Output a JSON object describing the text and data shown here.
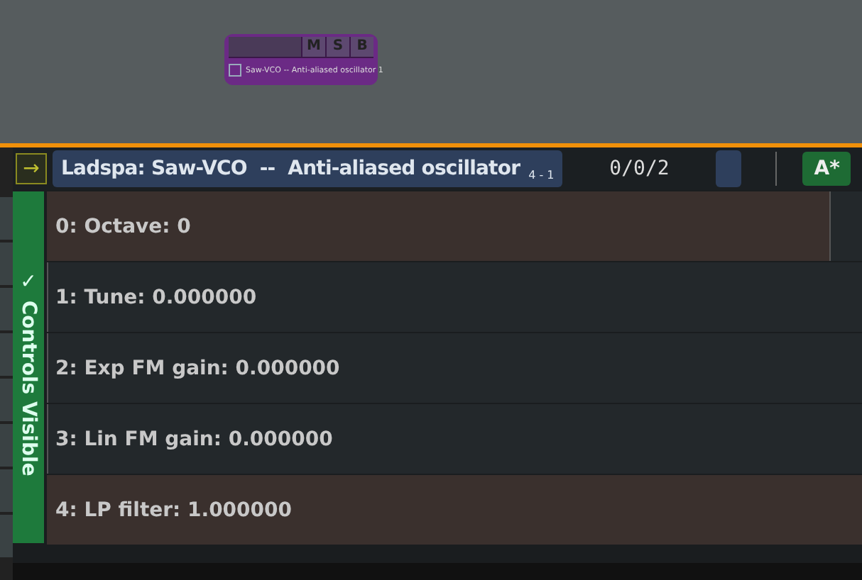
{
  "mini_plugin": {
    "buttons": [
      {
        "label": "M"
      },
      {
        "label": "S"
      },
      {
        "label": "B"
      }
    ],
    "checked": false,
    "name": "Saw-VCO -- Anti-aliased oscillator 1"
  },
  "header": {
    "arrow": "→",
    "title": "Ladspa: Saw-VCO  --  Anti-aliased oscillator",
    "ports": "4 - 1",
    "counter": "0/0/2",
    "automation": "A*"
  },
  "sidebar": {
    "label": "✓ Controls Visible"
  },
  "controls": [
    {
      "label": "0: Octave: 0",
      "level": 0.96
    },
    {
      "label": "1: Tune: 0.000000",
      "level": 0
    },
    {
      "label": "2: Exp FM gain: 0.000000",
      "level": 0
    },
    {
      "label": "3: Lin FM gain: 0.000000",
      "level": 0
    },
    {
      "label": "4: LP filter: 1.000000",
      "level": 1
    }
  ]
}
